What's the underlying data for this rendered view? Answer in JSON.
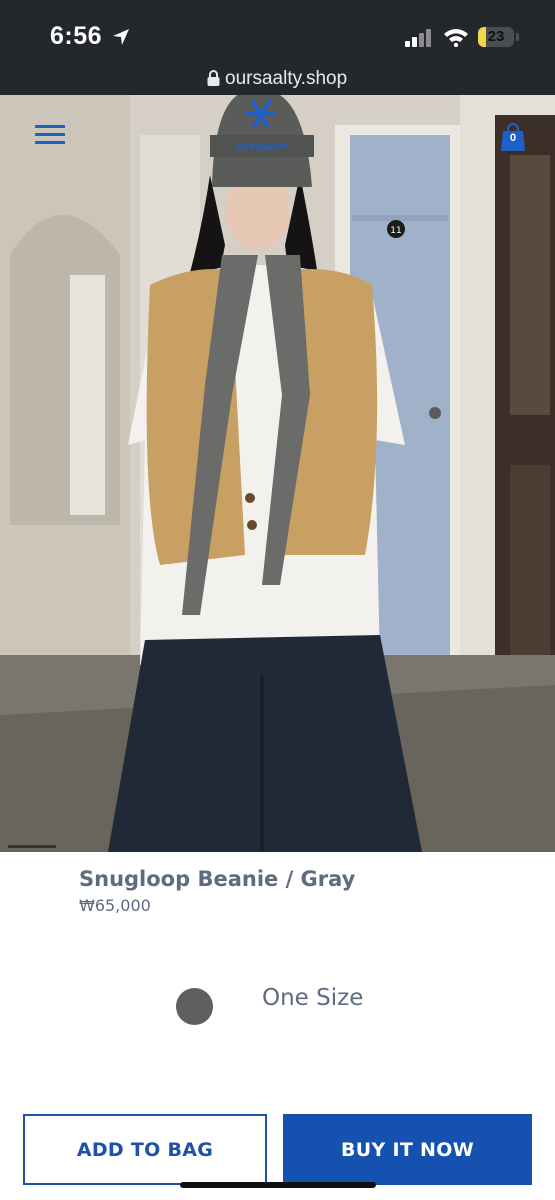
{
  "status_bar": {
    "time": "6:56",
    "battery_percent": "23",
    "battery_level": 0.23
  },
  "browser": {
    "url": "oursaalty.shop"
  },
  "header": {
    "menu_icon": "hamburger-icon",
    "cart_icon": "shopping-bag-icon",
    "cart_count": "0",
    "accent_color": "#1e60c8"
  },
  "hero": {
    "logo_text": "OURSAALTY",
    "door_number": "11"
  },
  "product": {
    "name": "Snugloop Beanie / Gray",
    "price": "₩65,000",
    "color_swatch": "#5f5f61",
    "size": "One Size"
  },
  "actions": {
    "add_to_bag": "ADD TO BAG",
    "buy_now": "BUY IT NOW",
    "primary_color": "#1552b0"
  }
}
